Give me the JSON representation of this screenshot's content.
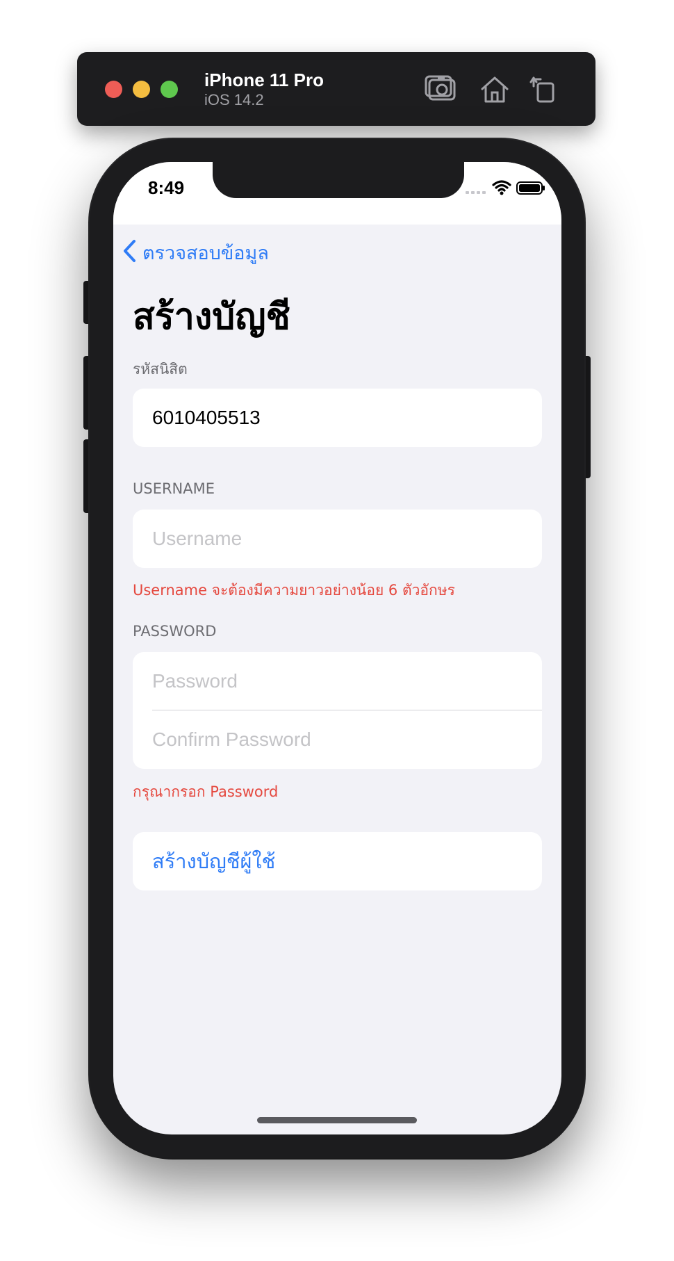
{
  "simulator": {
    "device_name": "iPhone 11 Pro",
    "os_version": "iOS 14.2",
    "toolbar_icons": [
      "screenshot-icon",
      "home-icon",
      "rotate-icon"
    ]
  },
  "status_bar": {
    "time": "8:49",
    "icons": [
      "cellular-signal-icon",
      "wifi-icon",
      "battery-icon"
    ]
  },
  "nav": {
    "back_label": "ตรวจสอบข้อมูล",
    "title": "สร้างบัญชี"
  },
  "form": {
    "student_id": {
      "header": "รหัสนิสิต",
      "value": "6010405513"
    },
    "username": {
      "header": "USERNAME",
      "placeholder": "Username",
      "value": "",
      "error": "Username จะต้องมีความยาวอย่างน้อย 6 ตัวอักษร"
    },
    "password": {
      "header": "PASSWORD",
      "placeholder": "Password",
      "confirm_placeholder": "Confirm Password",
      "error": "กรุณากรอก Password"
    },
    "submit_label": "สร้างบัญชีผู้ใช้"
  },
  "colors": {
    "accent": "#2f7cf6",
    "error": "#e5483e",
    "background": "#f2f2f7"
  }
}
